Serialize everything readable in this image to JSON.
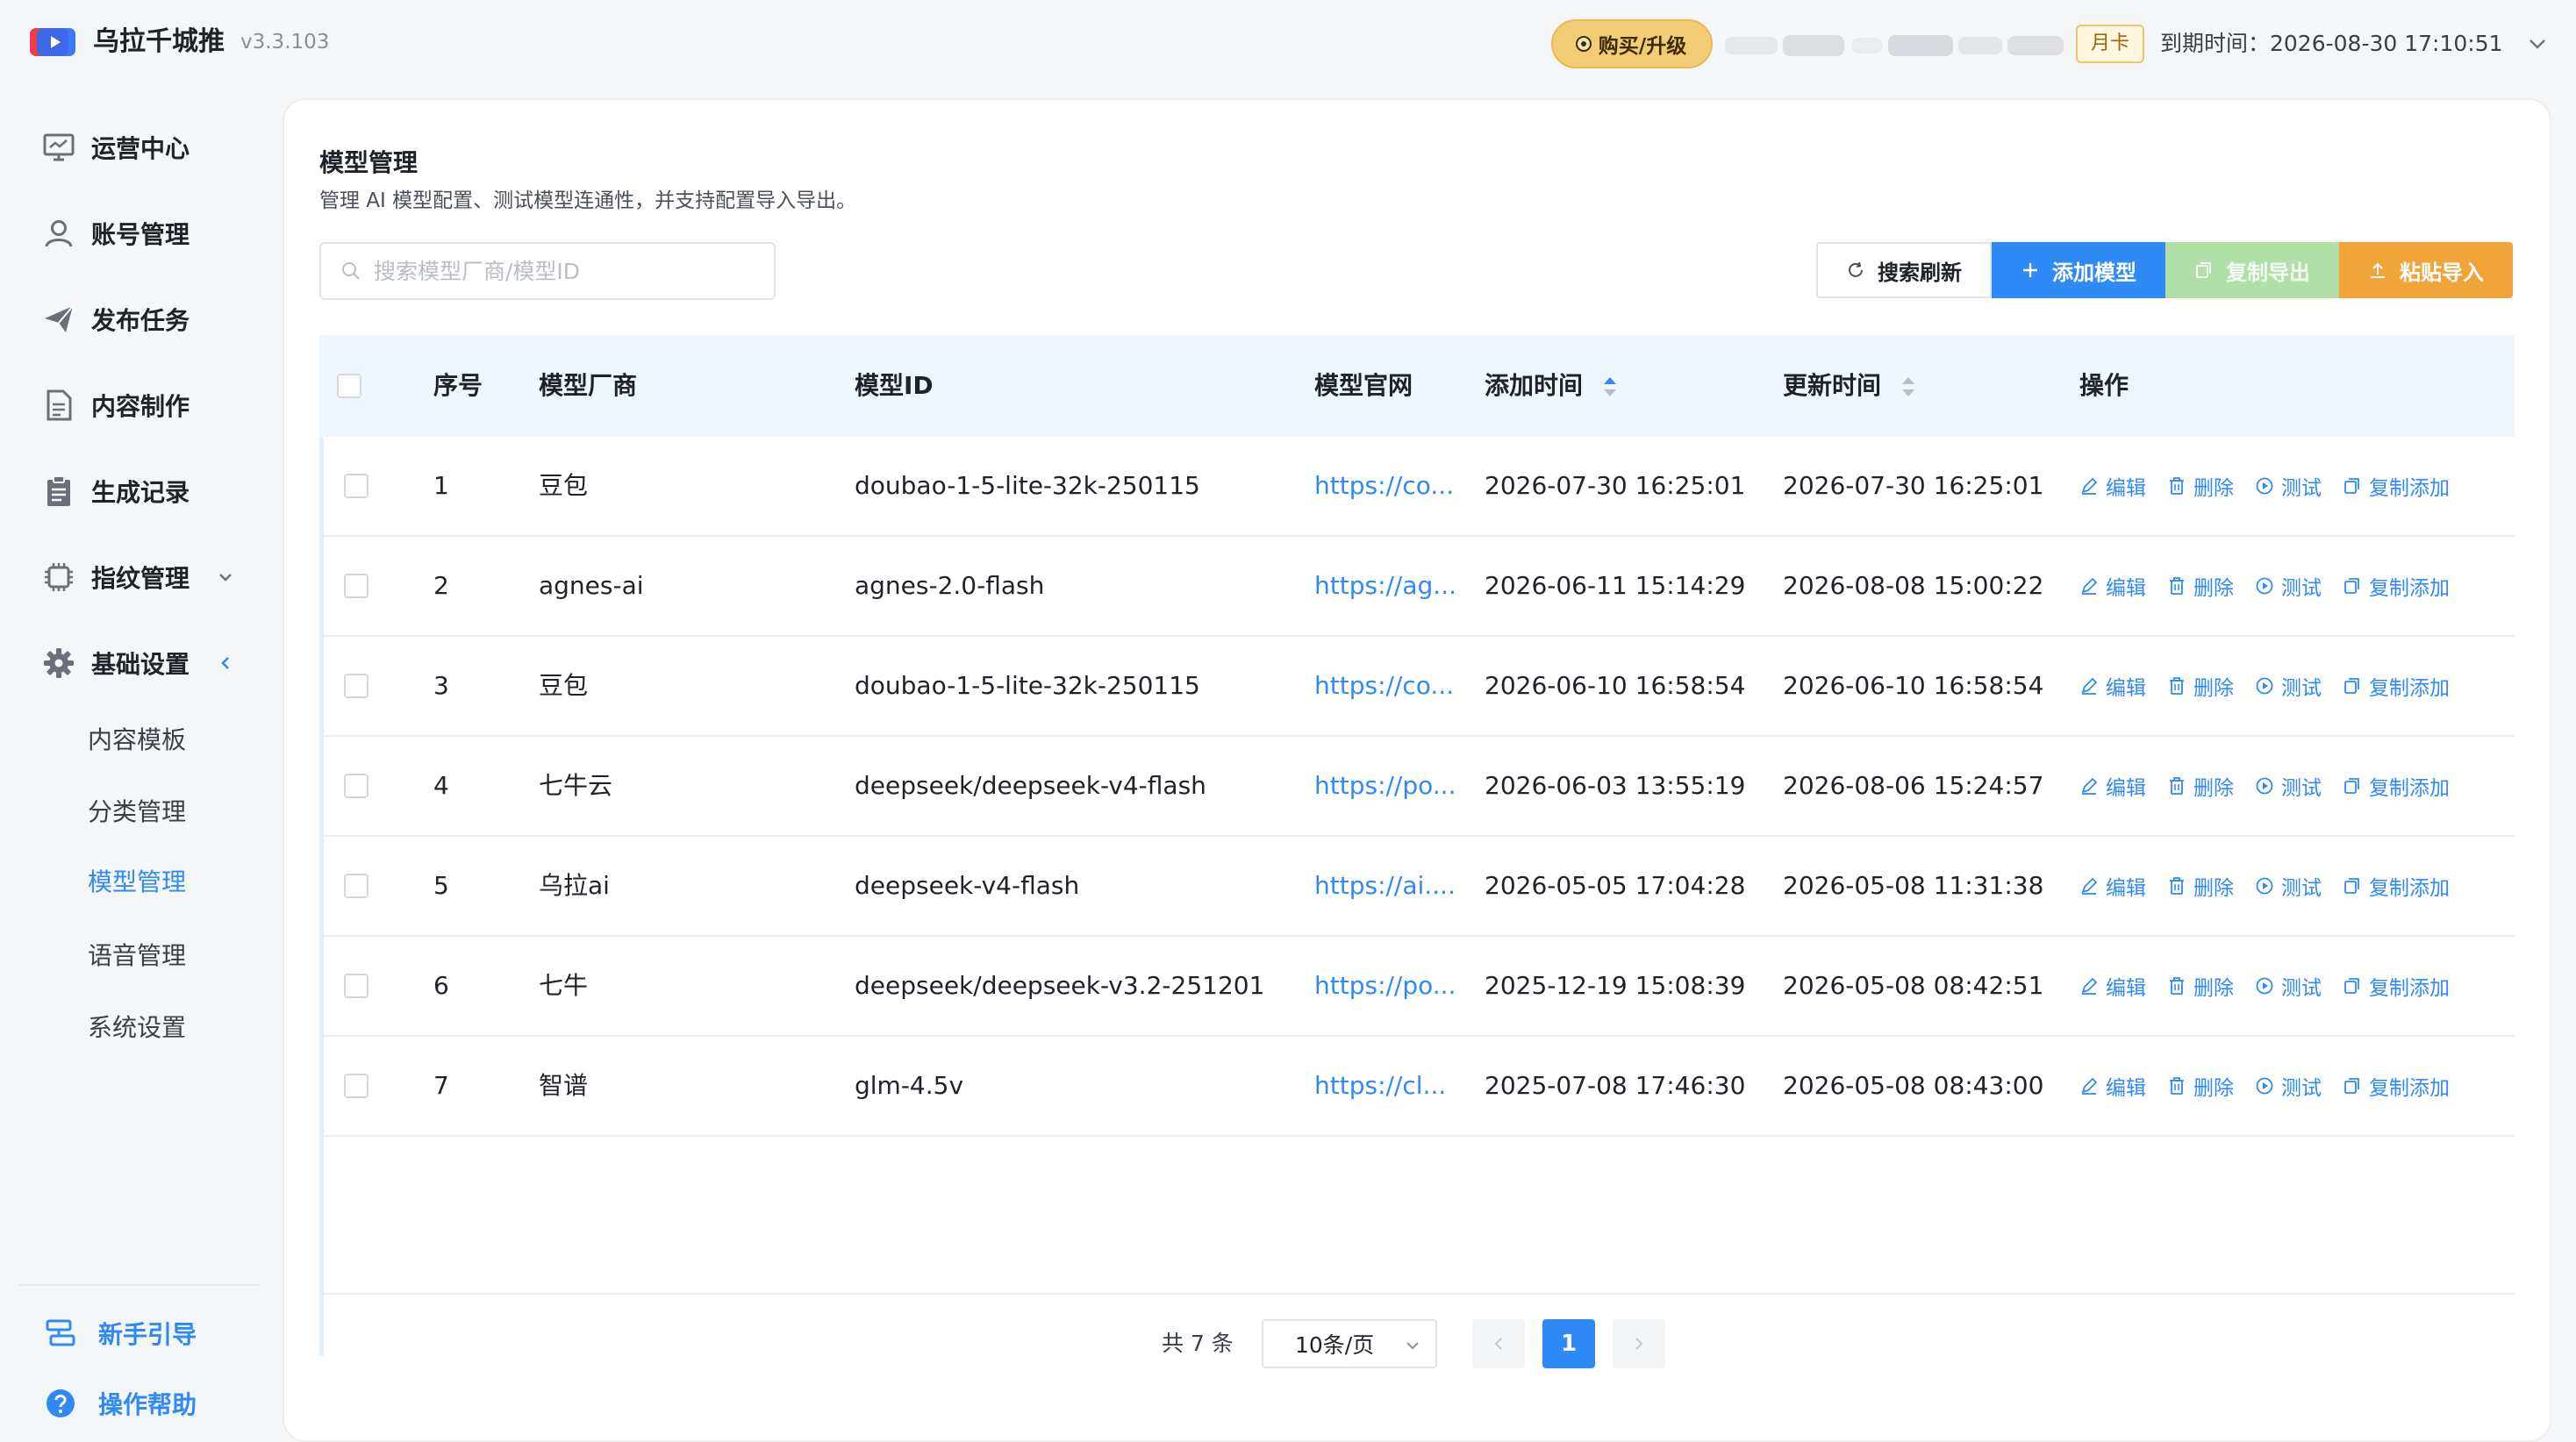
{
  "app": {
    "name": "乌拉千城推",
    "version": "v3.3.103",
    "buy_label": "购买/升级",
    "card_badge": "月卡",
    "expire_label": "到期时间：2026-08-30 17:10:51"
  },
  "sidebar": {
    "items": [
      {
        "label": "运营中心",
        "icon": "monitor-icon"
      },
      {
        "label": "账号管理",
        "icon": "user-icon"
      },
      {
        "label": "发布任务",
        "icon": "send-icon"
      },
      {
        "label": "内容制作",
        "icon": "document-icon"
      },
      {
        "label": "生成记录",
        "icon": "clipboard-icon"
      },
      {
        "label": "指纹管理",
        "icon": "chip-icon"
      },
      {
        "label": "基础设置",
        "icon": "gear-icon"
      }
    ],
    "sub_items": [
      {
        "label": "内容模板"
      },
      {
        "label": "分类管理"
      },
      {
        "label": "模型管理",
        "active": true
      },
      {
        "label": "语音管理"
      },
      {
        "label": "系统设置"
      }
    ],
    "bottom": [
      {
        "label": "新手引导",
        "icon": "guide-icon"
      },
      {
        "label": "操作帮助",
        "icon": "help-icon"
      }
    ]
  },
  "page": {
    "title": "模型管理",
    "description": "管理 AI 模型配置、测试模型连通性，并支持配置导入导出。",
    "search_placeholder": "搜索模型厂商/模型ID"
  },
  "toolbar": {
    "refresh": "搜索刷新",
    "add": "添加模型",
    "export": "复制导出",
    "import": "粘贴导入"
  },
  "table": {
    "columns": {
      "index": "序号",
      "vendor": "模型厂商",
      "model_id": "模型ID",
      "website": "模型官网",
      "created": "添加时间",
      "updated": "更新时间",
      "actions": "操作"
    },
    "actions": {
      "edit": "编辑",
      "delete": "删除",
      "test": "测试",
      "copy_add": "复制添加"
    },
    "rows": [
      {
        "index": "1",
        "vendor": "豆包",
        "model_id": "doubao-1-5-lite-32k-250115",
        "website": "https://co...",
        "created": "2026-07-30 16:25:01",
        "updated": "2026-07-30 16:25:01"
      },
      {
        "index": "2",
        "vendor": "agnes-ai",
        "model_id": "agnes-2.0-flash",
        "website": "https://ag...",
        "created": "2026-06-11 15:14:29",
        "updated": "2026-08-08 15:00:22"
      },
      {
        "index": "3",
        "vendor": "豆包",
        "model_id": "doubao-1-5-lite-32k-250115",
        "website": "https://co...",
        "created": "2026-06-10 16:58:54",
        "updated": "2026-06-10 16:58:54"
      },
      {
        "index": "4",
        "vendor": "七牛云",
        "model_id": "deepseek/deepseek-v4-flash",
        "website": "https://po...",
        "created": "2026-06-03 13:55:19",
        "updated": "2026-08-06 15:24:57"
      },
      {
        "index": "5",
        "vendor": "乌拉ai",
        "model_id": "deepseek-v4-flash",
        "website": "https://ai....",
        "created": "2026-05-05 17:04:28",
        "updated": "2026-05-08 11:31:38"
      },
      {
        "index": "6",
        "vendor": "七牛",
        "model_id": "deepseek/deepseek-v3.2-251201",
        "website": "https://po...",
        "created": "2025-12-19 15:08:39",
        "updated": "2026-05-08 08:42:51"
      },
      {
        "index": "7",
        "vendor": "智谱",
        "model_id": "glm-4.5v",
        "website": "https://cl...",
        "created": "2025-07-08 17:46:30",
        "updated": "2026-05-08 08:43:00"
      }
    ]
  },
  "pagination": {
    "total": "共 7 条",
    "page_size": "10条/页",
    "current": "1"
  },
  "colors": {
    "primary": "#2f8af5",
    "export": "#b1dfa7",
    "import": "#f0a43a",
    "buy": "#f3cd76"
  }
}
